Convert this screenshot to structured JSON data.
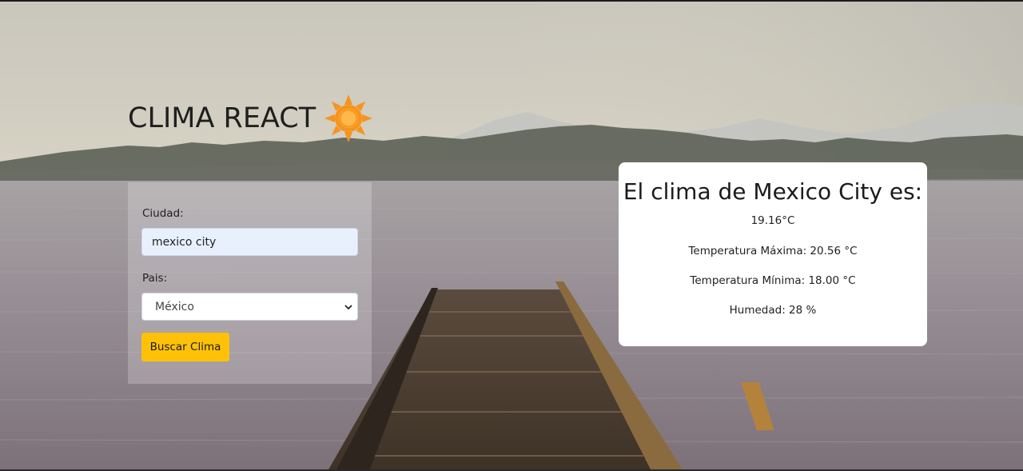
{
  "app": {
    "title": "CLIMA REACT",
    "icon": "sun-icon",
    "colors": {
      "accent": "#ffc107",
      "sun": "#f7941d",
      "input_bg": "#e8f0fe"
    }
  },
  "form": {
    "city_label": "Ciudad:",
    "city_value": "mexico city",
    "country_label": "Pais:",
    "country_value": "México",
    "submit_label": "Buscar Clima"
  },
  "result": {
    "title": "El clima de Mexico City es:",
    "temperature": "19.16°C",
    "max_temp": "Temperatura Máxima: 20.56 °C",
    "min_temp": "Temperatura Mínima: 18.00 °C",
    "humidity": "Humedad: 28 %"
  }
}
